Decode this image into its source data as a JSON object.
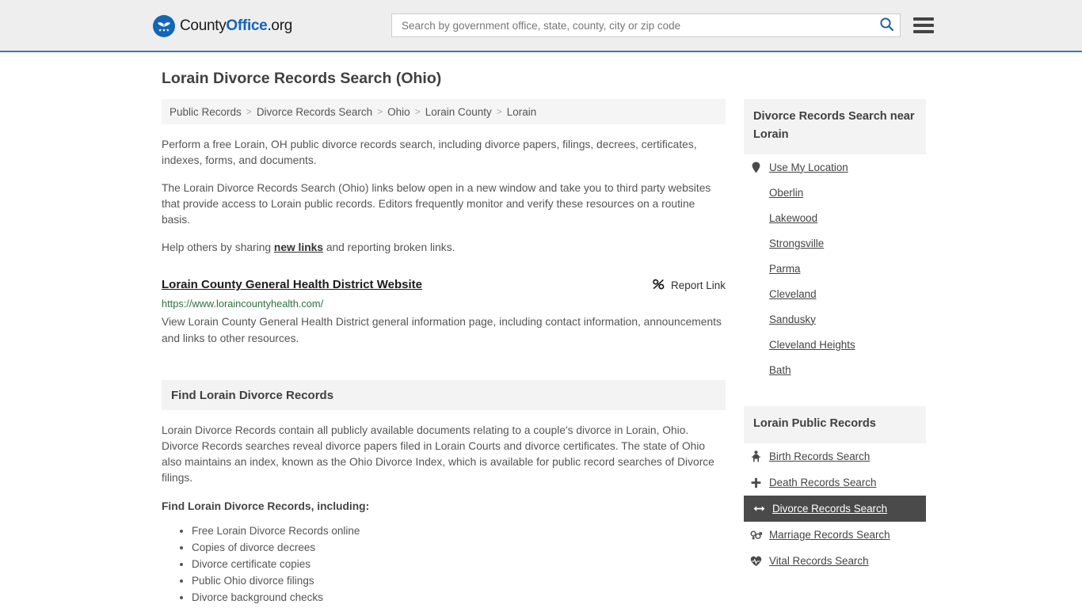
{
  "header": {
    "logo": {
      "icon": "eagle-shield-icon",
      "text_county": "County",
      "text_office": "Office",
      "text_org": ".org"
    },
    "search": {
      "placeholder": "Search by government office, state, county, city or zip code",
      "value": "",
      "search_icon": "search-icon",
      "accent_color": "#1565b5"
    },
    "menu_icon": "hamburger-menu-icon",
    "border_color": "#3b7ab3"
  },
  "page": {
    "title": "Lorain Divorce Records Search (Ohio)"
  },
  "breadcrumb": {
    "separator": ">",
    "items": [
      {
        "label": "Public Records"
      },
      {
        "label": "Divorce Records Search"
      },
      {
        "label": "Ohio"
      },
      {
        "label": "Lorain County"
      },
      {
        "label": "Lorain"
      }
    ]
  },
  "intro": {
    "paragraph1": "Perform a free Lorain, OH public divorce records search, including divorce papers, filings, decrees, certificates, indexes, forms, and documents.",
    "paragraph2": "The Lorain Divorce Records Search (Ohio) links below open in a new window and take you to third party websites that provide access to Lorain public records. Editors frequently monitor and verify these resources on a routine basis.",
    "share_prefix": "Help others by sharing ",
    "share_link": "new links",
    "share_suffix": " and reporting broken links."
  },
  "result": {
    "title": "Lorain County General Health District Website",
    "url": "https://www.loraincountyhealth.com/",
    "url_color": "#31703d",
    "description": "View Lorain County General Health District general information page, including contact information, announcements and links to other resources.",
    "report_label": "Report Link",
    "report_icon": "broken-link-icon"
  },
  "section": {
    "heading": "Find Lorain Divorce Records",
    "body": "Lorain Divorce Records contain all publicly available documents relating to a couple's divorce in Lorain, Ohio. Divorce Records searches reveal divorce papers filed in Lorain Courts and divorce certificates. The state of Ohio also maintains an index, known as the Ohio Divorce Index, which is available for public record searches of Divorce filings.",
    "list_heading": "Find Lorain Divorce Records, including:",
    "bullets": [
      "Free Lorain Divorce Records online",
      "Copies of divorce decrees",
      "Divorce certificate copies",
      "Public Ohio divorce filings",
      "Divorce background checks"
    ]
  },
  "sidebar": {
    "nearby": {
      "heading": "Divorce Records Search near Lorain",
      "items": [
        {
          "label": "Use My Location",
          "icon": "map-pin-icon"
        },
        {
          "label": "Oberlin",
          "icon": ""
        },
        {
          "label": "Lakewood",
          "icon": ""
        },
        {
          "label": "Strongsville",
          "icon": ""
        },
        {
          "label": "Parma",
          "icon": ""
        },
        {
          "label": "Cleveland",
          "icon": ""
        },
        {
          "label": "Sandusky",
          "icon": ""
        },
        {
          "label": "Cleveland Heights",
          "icon": ""
        },
        {
          "label": "Bath",
          "icon": ""
        }
      ]
    },
    "records": {
      "heading": "Lorain Public Records",
      "highlight_color": "#4a4a4a",
      "items": [
        {
          "label": "Birth Records Search",
          "icon": "baby-icon",
          "active": false
        },
        {
          "label": "Death Records Search",
          "icon": "cross-icon",
          "active": false
        },
        {
          "label": "Divorce Records Search",
          "icon": "double-arrow-icon",
          "active": true
        },
        {
          "label": "Marriage Records Search",
          "icon": "gender-symbols-icon",
          "active": false
        },
        {
          "label": "Vital Records Search",
          "icon": "heartbeat-icon",
          "active": false
        }
      ]
    }
  }
}
